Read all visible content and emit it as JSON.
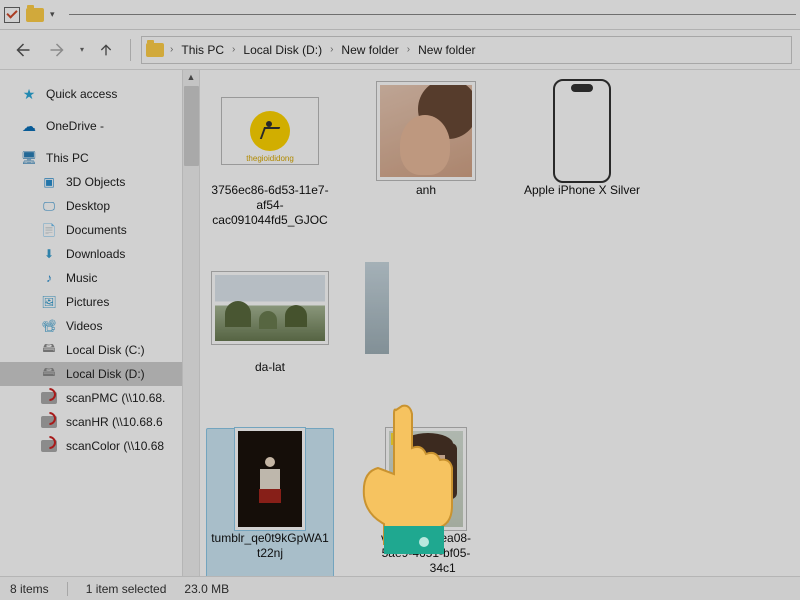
{
  "breadcrumb": [
    "This PC",
    "Local Disk (D:)",
    "New folder",
    "New folder"
  ],
  "sidebar": {
    "quick_access": "Quick access",
    "onedrive": "OneDrive -",
    "this_pc": "This PC",
    "items": [
      "3D Objects",
      "Desktop",
      "Documents",
      "Downloads",
      "Music",
      "Pictures",
      "Videos"
    ],
    "drives": [
      "Local Disk (C:)",
      "Local Disk (D:)"
    ],
    "network_drives": [
      "scanPMC (\\\\10.68.",
      "scanHR (\\\\10.68.6",
      "scanColor (\\\\10.68"
    ]
  },
  "files": [
    {
      "name": "3756ec86-6d53-11e7-af54-cac091044fd5_GJOC"
    },
    {
      "name": "anh"
    },
    {
      "name": "Apple iPhone X Silver"
    },
    {
      "name": "da-lat"
    },
    {
      "name": "tumblr_qe0t9kGpWA1t22nj"
    },
    {
      "name": "v2018d064ea08-5ae9-4651-bf05-"
    },
    {
      "name_suffix": "34c1"
    }
  ],
  "status": {
    "count": "8 items",
    "selection": "1 item selected",
    "size": "23.0 MB"
  }
}
